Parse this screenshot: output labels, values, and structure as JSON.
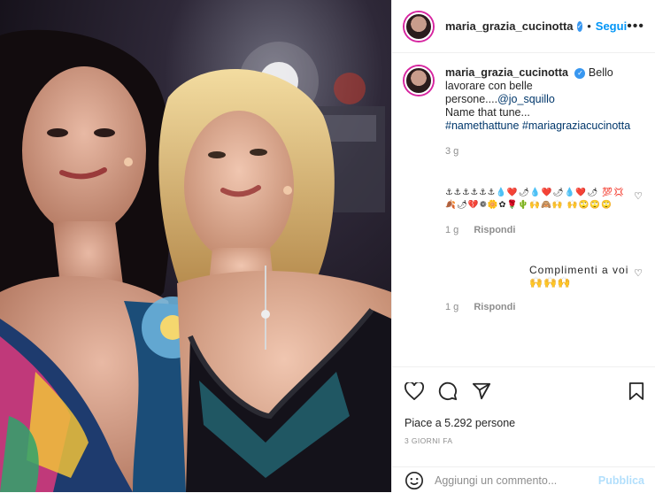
{
  "post": {
    "username": "maria_grazia_cucinotta",
    "follow_label": "Segui",
    "separator": "•",
    "more_label": "•••"
  },
  "caption": {
    "username": "maria_grazia_cucinotta",
    "text_1": "Bello lavorare con belle persone....",
    "mention": "@jo_squillo",
    "text_2": "Name that tune...",
    "hashtag_1": "#namethattune",
    "hashtag_2": "#mariagraziacucinotta",
    "time": "3 g"
  },
  "comments": [
    {
      "text": "⚓⚓⚓⚓⚓⚓💧❤️🌶💧❤️🌶💧❤️🌶 💯💢🍂🌶💔❁🌼✿🌹🌵🙌🙈🙌 🙌🙄🙄🙄",
      "time": "1 g",
      "reply": "Rispondi"
    },
    {
      "text": "Complimenti a voi 🙌🙌🙌",
      "time": "1 g",
      "reply": "Rispondi"
    }
  ],
  "likes": "Piace a 5.292 persone",
  "posted_ago": "3 GIORNI FA",
  "comment_input": {
    "placeholder": "Aggiungi un commento...",
    "publish_label": "Pubblica"
  },
  "colors": {
    "accent": "#0095f6",
    "verified": "#3897f0",
    "publish_disabled": "#b2dffc"
  }
}
